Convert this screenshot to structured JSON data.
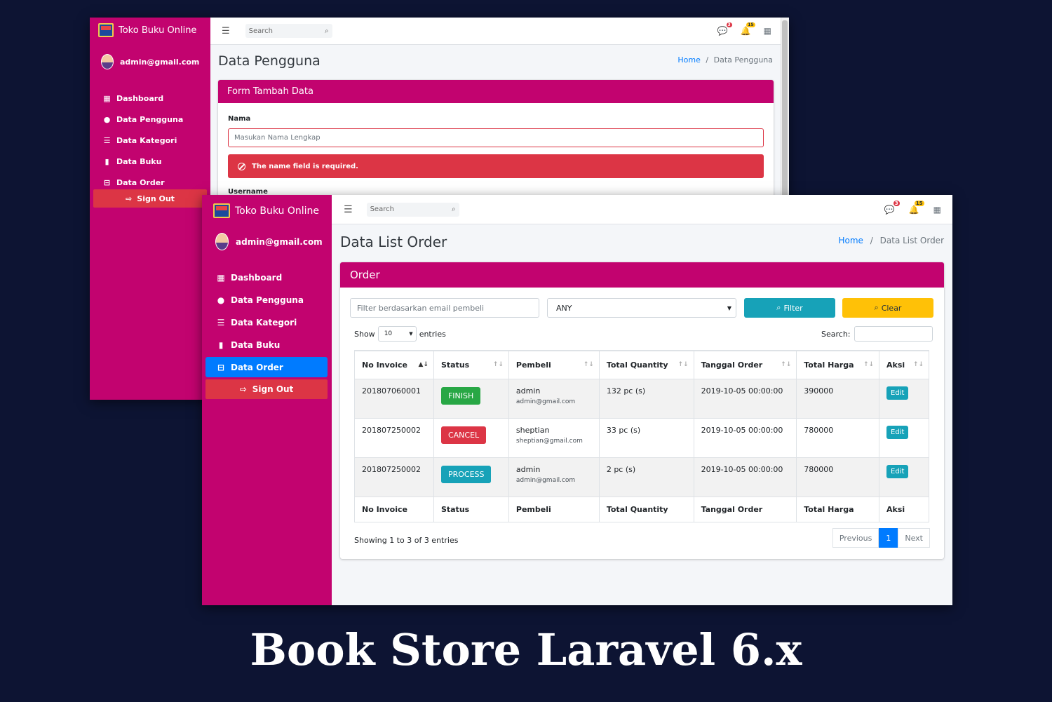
{
  "app": {
    "brand": "Toko Buku Online",
    "user": "admin@gmail.com",
    "nav": [
      {
        "label": "Dashboard",
        "icon": "grid-icon"
      },
      {
        "label": "Data Pengguna",
        "icon": "user-circle-icon"
      },
      {
        "label": "Data Kategori",
        "icon": "list-icon"
      },
      {
        "label": "Data Buku",
        "icon": "book-icon"
      },
      {
        "label": "Data Order",
        "icon": "basket-icon"
      }
    ],
    "sign_out": "Sign Out",
    "search_placeholder": "Search",
    "badges": {
      "messages": "3",
      "notifications": "15"
    },
    "home": "Home",
    "crumb_sep": "/"
  },
  "window1": {
    "title": "Data Pengguna",
    "crumb_current": "Data Pengguna",
    "card_title": "Form Tambah Data",
    "name_label": "Nama",
    "name_placeholder": "Masukan Nama Lengkap",
    "error": "The name field is required.",
    "username_label": "Username"
  },
  "window2": {
    "title": "Data List Order",
    "crumb_current": "Data List Order",
    "card_title": "Order",
    "filter_placeholder": "Filter berdasarkan email pembeli",
    "status_value": "ANY",
    "filter_btn": "Filter",
    "clear_btn": "Clear",
    "show_label": "Show",
    "entries_value": "10",
    "entries_label": "entries",
    "search_label": "Search:",
    "columns": [
      "No Invoice",
      "Status",
      "Pembeli",
      "Total Quantity",
      "Tanggal Order",
      "Total Harga",
      "Aksi"
    ],
    "rows": [
      {
        "invoice": "201807060001",
        "status": "FINISH",
        "buyer": "admin",
        "email": "admin@gmail.com",
        "qty": "132 pc (s)",
        "date": "2019-10-05 00:00:00",
        "total": "390000",
        "action": "Edit"
      },
      {
        "invoice": "201807250002",
        "status": "CANCEL",
        "buyer": "sheptian",
        "email": "sheptian@gmail.com",
        "qty": "33 pc (s)",
        "date": "2019-10-05 00:00:00",
        "total": "780000",
        "action": "Edit"
      },
      {
        "invoice": "201807250002",
        "status": "PROCESS",
        "buyer": "admin",
        "email": "admin@gmail.com",
        "qty": "2 pc (s)",
        "date": "2019-10-05 00:00:00",
        "total": "780000",
        "action": "Edit"
      }
    ],
    "info": "Showing 1 to 3 of 3 entries",
    "pager": {
      "prev": "Previous",
      "page": "1",
      "next": "Next"
    }
  },
  "banner": "Book Store Laravel 6.x"
}
